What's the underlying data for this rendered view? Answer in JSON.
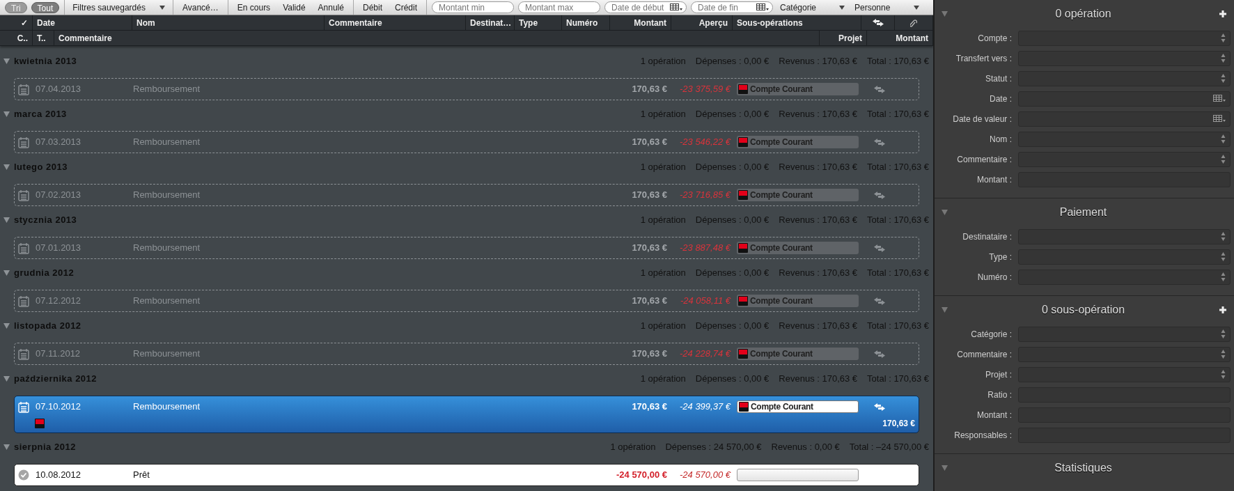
{
  "toolbar": {
    "groups": [
      [
        {
          "kind": "pill",
          "label": "Tri",
          "selected": false
        },
        {
          "kind": "pill",
          "label": "Tout",
          "selected": true
        }
      ],
      [
        {
          "kind": "dropdown",
          "label": "Filtres sauvegardés"
        }
      ],
      [
        {
          "kind": "button",
          "label": "Avancé…"
        }
      ],
      [
        {
          "kind": "button",
          "label": "En cours"
        },
        {
          "kind": "button",
          "label": "Validé"
        },
        {
          "kind": "button",
          "label": "Annulé"
        }
      ],
      [
        {
          "kind": "button",
          "label": "Débit"
        },
        {
          "kind": "button",
          "label": "Crédit"
        }
      ],
      [
        {
          "kind": "search",
          "placeholder": "Montant min"
        },
        {
          "kind": "search",
          "placeholder": "Montant max"
        },
        {
          "kind": "date",
          "placeholder": "Date de début"
        },
        {
          "kind": "date",
          "placeholder": "Date de fin"
        },
        {
          "kind": "dropdown",
          "label": "Catégorie"
        },
        {
          "kind": "dropdown",
          "label": "Personne"
        }
      ]
    ]
  },
  "table": {
    "columns": [
      {
        "kind": "text",
        "label": "✓"
      },
      {
        "kind": "text",
        "label": "Date"
      },
      {
        "kind": "text",
        "label": "Nom"
      },
      {
        "kind": "text",
        "label": "Commentaire"
      },
      {
        "kind": "text",
        "label": "Destinat…"
      },
      {
        "kind": "text",
        "label": "Type"
      },
      {
        "kind": "text",
        "label": "Numéro"
      },
      {
        "kind": "text",
        "label": "Montant"
      },
      {
        "kind": "text",
        "label": "Aperçu"
      },
      {
        "kind": "text",
        "label": "Sous-opérations"
      },
      {
        "kind": "transfer"
      },
      {
        "kind": "attachment"
      }
    ],
    "sub_columns": [
      {
        "label": "C.."
      },
      {
        "label": "T.."
      },
      {
        "label": "Commentaire"
      },
      {
        "label": "Projet"
      },
      {
        "label": "Montant"
      }
    ],
    "groups": [
      {
        "title": "kwietnia 2013",
        "expanded": true,
        "summary": [
          "1 opération",
          "Dépenses : 0,00 €",
          "Revenus : 170,63 €",
          "Total : 170,63 €"
        ],
        "transactions": [
          {
            "kind": "scheduled",
            "selected": false,
            "date": "07.04.2013",
            "name": "Remboursement",
            "amount": "170,63 €",
            "negative": false,
            "balance": "-23 375,59 €",
            "account": "Compte Courant",
            "transfer": true
          }
        ]
      },
      {
        "title": "marca 2013",
        "expanded": true,
        "summary": [
          "1 opération",
          "Dépenses : 0,00 €",
          "Revenus : 170,63 €",
          "Total : 170,63 €"
        ],
        "transactions": [
          {
            "kind": "scheduled",
            "selected": false,
            "date": "07.03.2013",
            "name": "Remboursement",
            "amount": "170,63 €",
            "negative": false,
            "balance": "-23 546,22 €",
            "account": "Compte Courant",
            "transfer": true
          }
        ]
      },
      {
        "title": "lutego 2013",
        "expanded": true,
        "summary": [
          "1 opération",
          "Dépenses : 0,00 €",
          "Revenus : 170,63 €",
          "Total : 170,63 €"
        ],
        "transactions": [
          {
            "kind": "scheduled",
            "selected": false,
            "date": "07.02.2013",
            "name": "Remboursement",
            "amount": "170,63 €",
            "negative": false,
            "balance": "-23 716,85 €",
            "account": "Compte Courant",
            "transfer": true
          }
        ]
      },
      {
        "title": "stycznia 2013",
        "expanded": true,
        "summary": [
          "1 opération",
          "Dépenses : 0,00 €",
          "Revenus : 170,63 €",
          "Total : 170,63 €"
        ],
        "transactions": [
          {
            "kind": "scheduled",
            "selected": false,
            "date": "07.01.2013",
            "name": "Remboursement",
            "amount": "170,63 €",
            "negative": false,
            "balance": "-23 887,48 €",
            "account": "Compte Courant",
            "transfer": true
          }
        ]
      },
      {
        "title": "grudnia 2012",
        "expanded": true,
        "summary": [
          "1 opération",
          "Dépenses : 0,00 €",
          "Revenus : 170,63 €",
          "Total : 170,63 €"
        ],
        "transactions": [
          {
            "kind": "scheduled",
            "selected": false,
            "date": "07.12.2012",
            "name": "Remboursement",
            "amount": "170,63 €",
            "negative": false,
            "balance": "-24 058,11 €",
            "account": "Compte Courant",
            "transfer": true
          }
        ]
      },
      {
        "title": "listopada 2012",
        "expanded": true,
        "summary": [
          "1 opération",
          "Dépenses : 0,00 €",
          "Revenus : 170,63 €",
          "Total : 170,63 €"
        ],
        "transactions": [
          {
            "kind": "scheduled",
            "selected": false,
            "date": "07.11.2012",
            "name": "Remboursement",
            "amount": "170,63 €",
            "negative": false,
            "balance": "-24 228,74 €",
            "account": "Compte Courant",
            "transfer": true
          }
        ]
      },
      {
        "title": "października 2012",
        "expanded": true,
        "summary": [
          "1 opération",
          "Dépenses : 0,00 €",
          "Revenus : 170,63 €",
          "Total : 170,63 €"
        ],
        "transactions": [
          {
            "kind": "scheduled",
            "selected": true,
            "date": "07.10.2012",
            "name": "Remboursement",
            "amount": "170,63 €",
            "negative": false,
            "balance": "-24 399,37 €",
            "account": "Compte Courant",
            "transfer": true,
            "split_amount": "170,63 €"
          }
        ]
      },
      {
        "title": "sierpnia 2012",
        "expanded": true,
        "summary": [
          "1 opération",
          "Dépenses : 24 570,00 €",
          "Revenus : 0,00 €",
          "Total : –24 570,00 €"
        ],
        "transactions": [
          {
            "kind": "cleared",
            "selected": false,
            "date": "10.08.2012",
            "name": "Prêt",
            "amount": "-24 570,00 €",
            "negative": true,
            "balance": "-24 570,00 €",
            "transfer": false
          }
        ]
      }
    ]
  },
  "inspector": {
    "sections": [
      {
        "title": "0 opération",
        "expanded": true,
        "add_button": true,
        "fields": [
          {
            "label": "Compte :",
            "kind": "popup"
          },
          {
            "label": "Transfert vers :",
            "kind": "popup"
          },
          {
            "label": "Statut :",
            "kind": "popup"
          },
          {
            "label": "Date :",
            "kind": "date"
          },
          {
            "label": "Date de valeur :",
            "kind": "date"
          },
          {
            "label": "Nom :",
            "kind": "popup"
          },
          {
            "label": "Commentaire :",
            "kind": "popup"
          },
          {
            "label": "Montant :",
            "kind": "text"
          }
        ]
      },
      {
        "title": "Paiement",
        "expanded": true,
        "add_button": false,
        "fields": [
          {
            "label": "Destinataire :",
            "kind": "popup"
          },
          {
            "label": "Type :",
            "kind": "popup"
          },
          {
            "label": "Numéro :",
            "kind": "popup"
          }
        ]
      },
      {
        "title": "0 sous-opération",
        "expanded": true,
        "add_button": true,
        "fields": [
          {
            "label": "Catégorie :",
            "kind": "popup"
          },
          {
            "label": "Commentaire :",
            "kind": "popup"
          },
          {
            "label": "Projet :",
            "kind": "popup"
          },
          {
            "label": "Ratio :",
            "kind": "text"
          },
          {
            "label": "Montant :",
            "kind": "text"
          },
          {
            "label": "Responsables :",
            "kind": "text"
          }
        ]
      },
      {
        "title": "Statistiques",
        "expanded": true,
        "add_button": false
      }
    ]
  }
}
